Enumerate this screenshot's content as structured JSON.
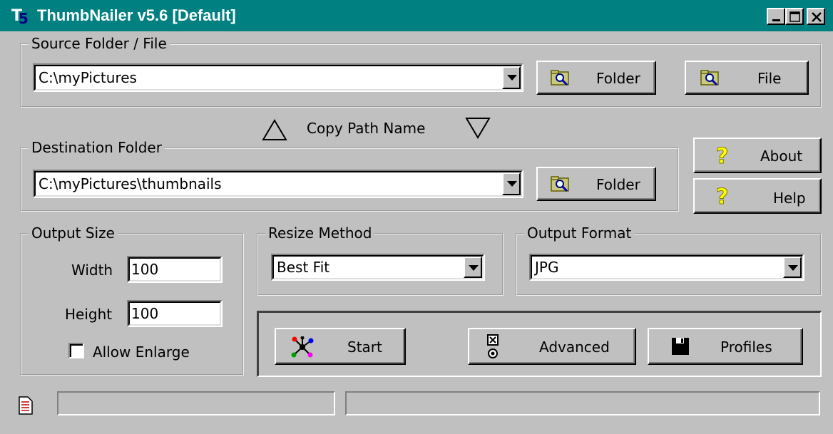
{
  "window": {
    "title": "ThumbNailer v5.6 [Default]",
    "title_bar_color": "#008080",
    "logo_letters": "T5"
  },
  "source": {
    "legend": "Source Folder / File",
    "path": "C:\\myPictures",
    "folder_button": "Folder",
    "file_button": "File"
  },
  "copy_path": {
    "label": "Copy Path Name"
  },
  "destination": {
    "legend": "Destination Folder",
    "path": "C:\\myPictures\\thumbnails",
    "folder_button": "Folder"
  },
  "side_buttons": {
    "about": "About",
    "help": "Help"
  },
  "output_size": {
    "legend": "Output Size",
    "width_label": "Width",
    "width_value": "100",
    "height_label": "Height",
    "height_value": "100",
    "allow_enlarge_label": "Allow Enlarge",
    "allow_enlarge_checked": false
  },
  "resize_method": {
    "legend": "Resize Method",
    "value": "Best Fit"
  },
  "output_format": {
    "legend": "Output Format",
    "value": "JPG"
  },
  "actions": {
    "start": "Start",
    "advanced": "Advanced",
    "profiles": "Profiles"
  },
  "status_bar": {
    "left": "",
    "right": ""
  }
}
